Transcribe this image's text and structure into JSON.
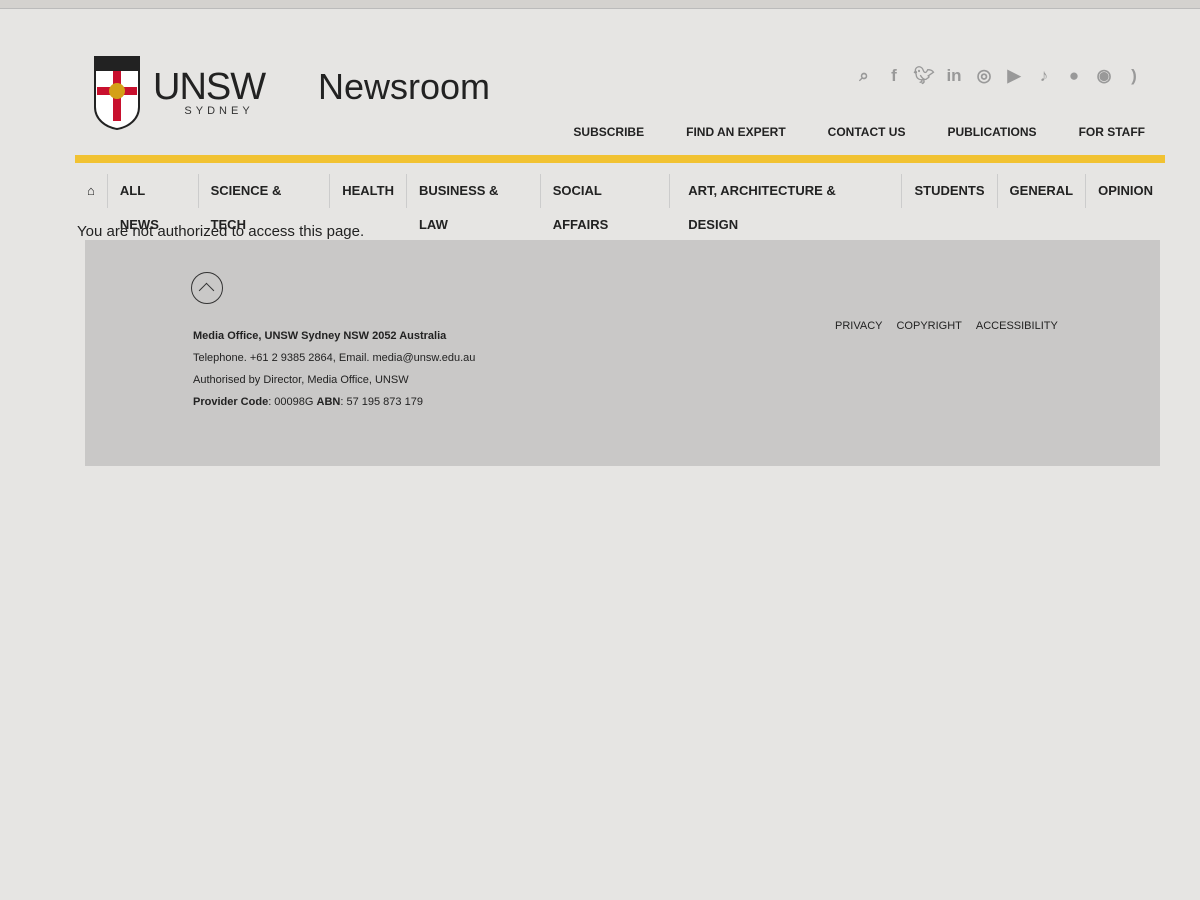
{
  "header": {
    "logo_text": "UNSW",
    "logo_sub": "SYDNEY",
    "site_title": "Newsroom",
    "social_icons": [
      "search-icon",
      "facebook-icon",
      "twitter-icon",
      "linkedin-icon",
      "instagram-icon",
      "youtube-icon",
      "tiktok-icon",
      "wechat-icon",
      "weibo-icon",
      "rss-icon"
    ],
    "top_links": [
      "SUBSCRIBE",
      "FIND AN EXPERT",
      "CONTACT US",
      "PUBLICATIONS",
      "FOR STAFF"
    ]
  },
  "nav": {
    "items": [
      "ALL NEWS",
      "SCIENCE & TECH",
      "HEALTH",
      "BUSINESS & LAW",
      "SOCIAL AFFAIRS",
      "ART, ARCHITECTURE & DESIGN",
      "STUDENTS",
      "GENERAL",
      "OPINION"
    ]
  },
  "main": {
    "message": "You are not authorized to access this page."
  },
  "footer": {
    "address": "Media Office, UNSW Sydney NSW 2052 Australia",
    "contact": "Telephone. +61 2 9385 2864, Email. media@unsw.edu.au",
    "authorised": "Authorised by Director, Media Office, UNSW",
    "provider_label": "Provider Code",
    "provider_value": ": 00098G ",
    "abn_label": "ABN",
    "abn_value": ": 57 195 873 179",
    "links": [
      "PRIVACY",
      "COPYRIGHT",
      "ACCESSIBILITY"
    ]
  },
  "colors": {
    "accent": "#f1c232",
    "footer_bg": "#c9c8c7"
  }
}
